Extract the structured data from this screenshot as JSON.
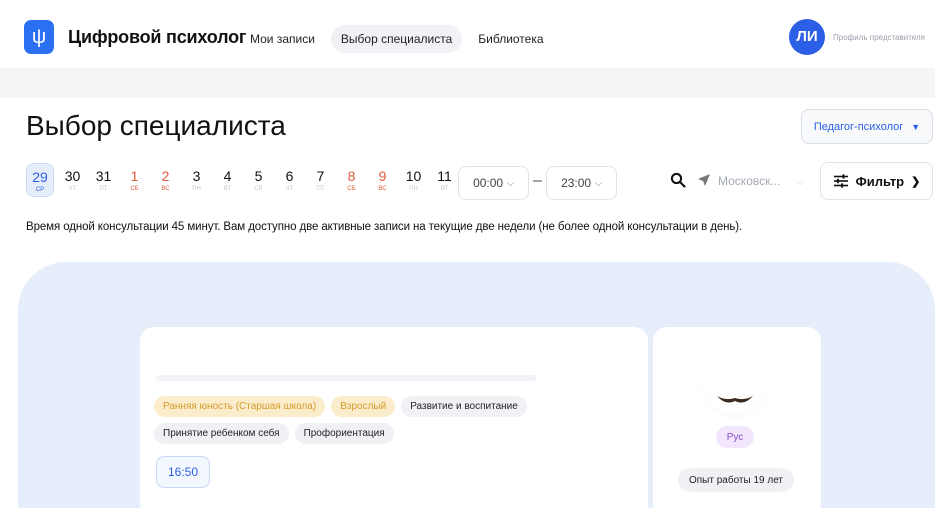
{
  "header": {
    "logo_glyph": "ψ",
    "app_title": "Цифровой психолог",
    "nav": [
      {
        "label": "Мои записи",
        "active": false
      },
      {
        "label": "Выбор специалиста",
        "active": true
      },
      {
        "label": "Библиотека",
        "active": false
      }
    ],
    "avatar_initials": "ЛИ",
    "profile_label": "Профиль представителя"
  },
  "page": {
    "title": "Выбор специалиста",
    "role_select": "Педагог-психолог"
  },
  "dates": [
    {
      "num": "29",
      "wd": "СР",
      "selected": true,
      "weekend": false
    },
    {
      "num": "30",
      "wd": "ЧТ",
      "selected": false,
      "weekend": false
    },
    {
      "num": "31",
      "wd": "ПТ",
      "selected": false,
      "weekend": false
    },
    {
      "num": "1",
      "wd": "СБ",
      "selected": false,
      "weekend": true
    },
    {
      "num": "2",
      "wd": "ВС",
      "selected": false,
      "weekend": true
    },
    {
      "num": "3",
      "wd": "ПН",
      "selected": false,
      "weekend": false
    },
    {
      "num": "4",
      "wd": "ВТ",
      "selected": false,
      "weekend": false
    },
    {
      "num": "5",
      "wd": "СР",
      "selected": false,
      "weekend": false
    },
    {
      "num": "6",
      "wd": "ЧТ",
      "selected": false,
      "weekend": false
    },
    {
      "num": "7",
      "wd": "ПТ",
      "selected": false,
      "weekend": false
    },
    {
      "num": "8",
      "wd": "СБ",
      "selected": false,
      "weekend": true
    },
    {
      "num": "9",
      "wd": "ВС",
      "selected": false,
      "weekend": true
    },
    {
      "num": "10",
      "wd": "ПН",
      "selected": false,
      "weekend": false
    },
    {
      "num": "11",
      "wd": "ВТ",
      "selected": false,
      "weekend": false
    }
  ],
  "time": {
    "from": "00:00",
    "to": "23:00",
    "dash": "–"
  },
  "location": {
    "city": "Московск..."
  },
  "filter": {
    "label": "Фильтр"
  },
  "info_text": "Время одной консультации 45 минут. Вам доступно две активные записи на текущие две недели (не более одной консультации в день).",
  "specialist": {
    "tags": [
      {
        "label": "Ранняя юность (Старшая школа)",
        "style": "yellow"
      },
      {
        "label": "Взрослый",
        "style": "yellow"
      },
      {
        "label": "Развитие и воспитание",
        "style": "gray"
      },
      {
        "label": "Принятие ребенком себя",
        "style": "gray"
      },
      {
        "label": "Профориентация",
        "style": "gray"
      }
    ],
    "slot": "16:50",
    "language": "Рус",
    "experience": "Опыт работы 19 лет"
  },
  "colors": {
    "accent": "#2b5fe6",
    "weekend": "#e05b3a",
    "panel_bg": "#e7eefb",
    "tag_yellow_bg": "#fbedcc",
    "tag_yellow_text": "#d49b28",
    "lang_bg": "#f1e6fb",
    "lang_text": "#8a4fcf"
  },
  "icons": {
    "search": "search-icon",
    "location": "location-arrow-icon",
    "filter": "filter-sliders-icon",
    "chevron": "chevron-down-icon"
  }
}
